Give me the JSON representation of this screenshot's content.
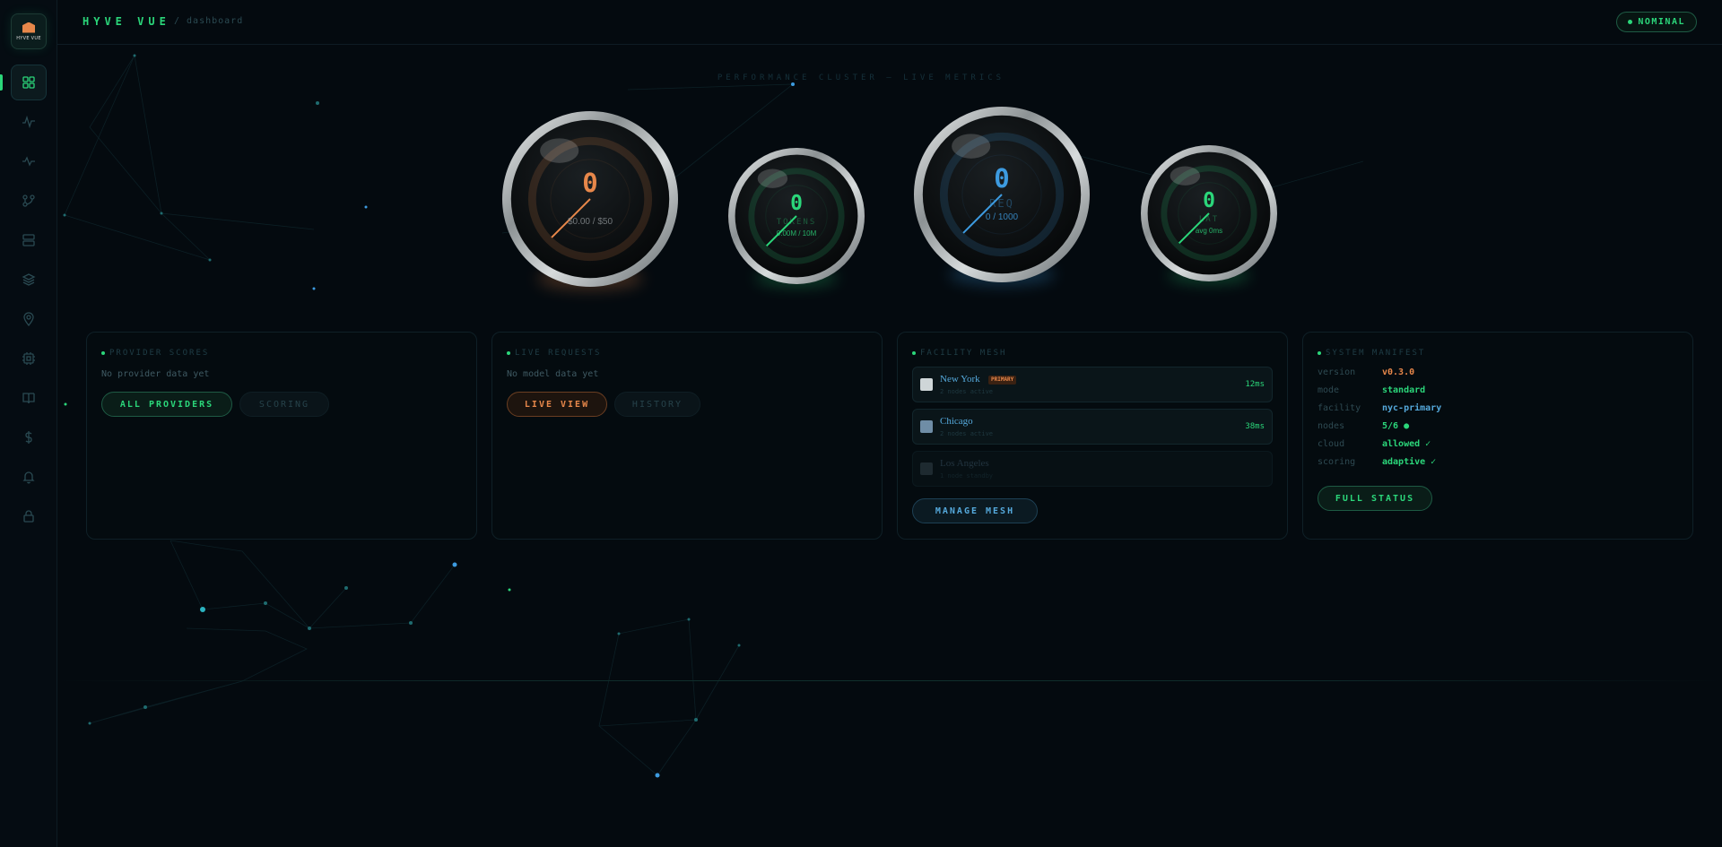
{
  "sidebar": {
    "logo_text": "HYVE VUE",
    "items": [
      {
        "name": "dashboard",
        "icon": "grid-icon",
        "active": true
      },
      {
        "name": "activity",
        "icon": "pulse-icon"
      },
      {
        "name": "metrics",
        "icon": "wave-icon"
      },
      {
        "name": "routing",
        "icon": "branch-icon"
      },
      {
        "name": "servers",
        "icon": "server-icon"
      },
      {
        "name": "layers",
        "icon": "layers-icon"
      },
      {
        "name": "locations",
        "icon": "map-pin-icon"
      },
      {
        "name": "hardware",
        "icon": "chip-icon"
      },
      {
        "name": "docs",
        "icon": "book-icon"
      },
      {
        "name": "billing",
        "icon": "dollar-icon"
      },
      {
        "name": "alerts",
        "icon": "bell-icon"
      },
      {
        "name": "security",
        "icon": "lock-icon"
      }
    ]
  },
  "header": {
    "brand": "HYVE VUE",
    "breadcrumb": "/ dashboard",
    "status": "NOMINAL"
  },
  "cluster": {
    "title": "PERFORMANCE CLUSTER — LIVE METRICS",
    "gauges": [
      {
        "id": "spend",
        "value": "0",
        "label": "",
        "sub": "$0.00 / $50",
        "color": "#e7874a",
        "fill": 0.0
      },
      {
        "id": "tokens",
        "value": "0",
        "label": "TOKENS",
        "sub": "0.00M / 10M",
        "color": "#2bd67a",
        "fill": 0.0
      },
      {
        "id": "requests",
        "value": "0",
        "label": "REQ",
        "sub": "0 / 1000",
        "color": "#3d9be0",
        "fill": 0.0
      },
      {
        "id": "latency",
        "value": "0",
        "label": "LAT",
        "sub": "avg 0ms",
        "color": "#2bd67a",
        "fill": 0.0
      }
    ]
  },
  "providers": {
    "title": "PROVIDER SCORES",
    "empty": "No provider data yet",
    "btn_primary": "ALL PROVIDERS",
    "btn_secondary": "SCORING"
  },
  "requests": {
    "title": "LIVE REQUESTS",
    "empty": "No model data yet",
    "btn_primary": "LIVE VIEW",
    "btn_secondary": "HISTORY"
  },
  "facility": {
    "title": "FACILITY MESH",
    "rows": [
      {
        "name": "New York",
        "badge": "PRIMARY",
        "sub": "2 nodes active",
        "latency": "12ms",
        "color": "#55a9dc"
      },
      {
        "name": "Chicago",
        "badge": "",
        "sub": "2 nodes active",
        "latency": "38ms",
        "color": "#55a9dc"
      },
      {
        "name": "Los Angeles",
        "badge": "",
        "sub": "1 node standby",
        "latency": "",
        "color": "#2b4350"
      }
    ],
    "btn": "MANAGE MESH"
  },
  "manifest": {
    "title": "SYSTEM MANIFEST",
    "rows": [
      {
        "key": "version",
        "value": "v0.3.0",
        "color": "#e7874a"
      },
      {
        "key": "mode",
        "value": "standard",
        "color": "#2bd67a"
      },
      {
        "key": "facility",
        "value": "nyc-primary",
        "color": "#55a9dc"
      },
      {
        "key": "nodes",
        "value": "5/6 ●",
        "color": "#2bd67a"
      },
      {
        "key": "cloud",
        "value": "allowed ✓",
        "color": "#2bd67a"
      },
      {
        "key": "scoring",
        "value": "adaptive ✓",
        "color": "#2bd67a"
      }
    ],
    "btn": "FULL STATUS"
  }
}
